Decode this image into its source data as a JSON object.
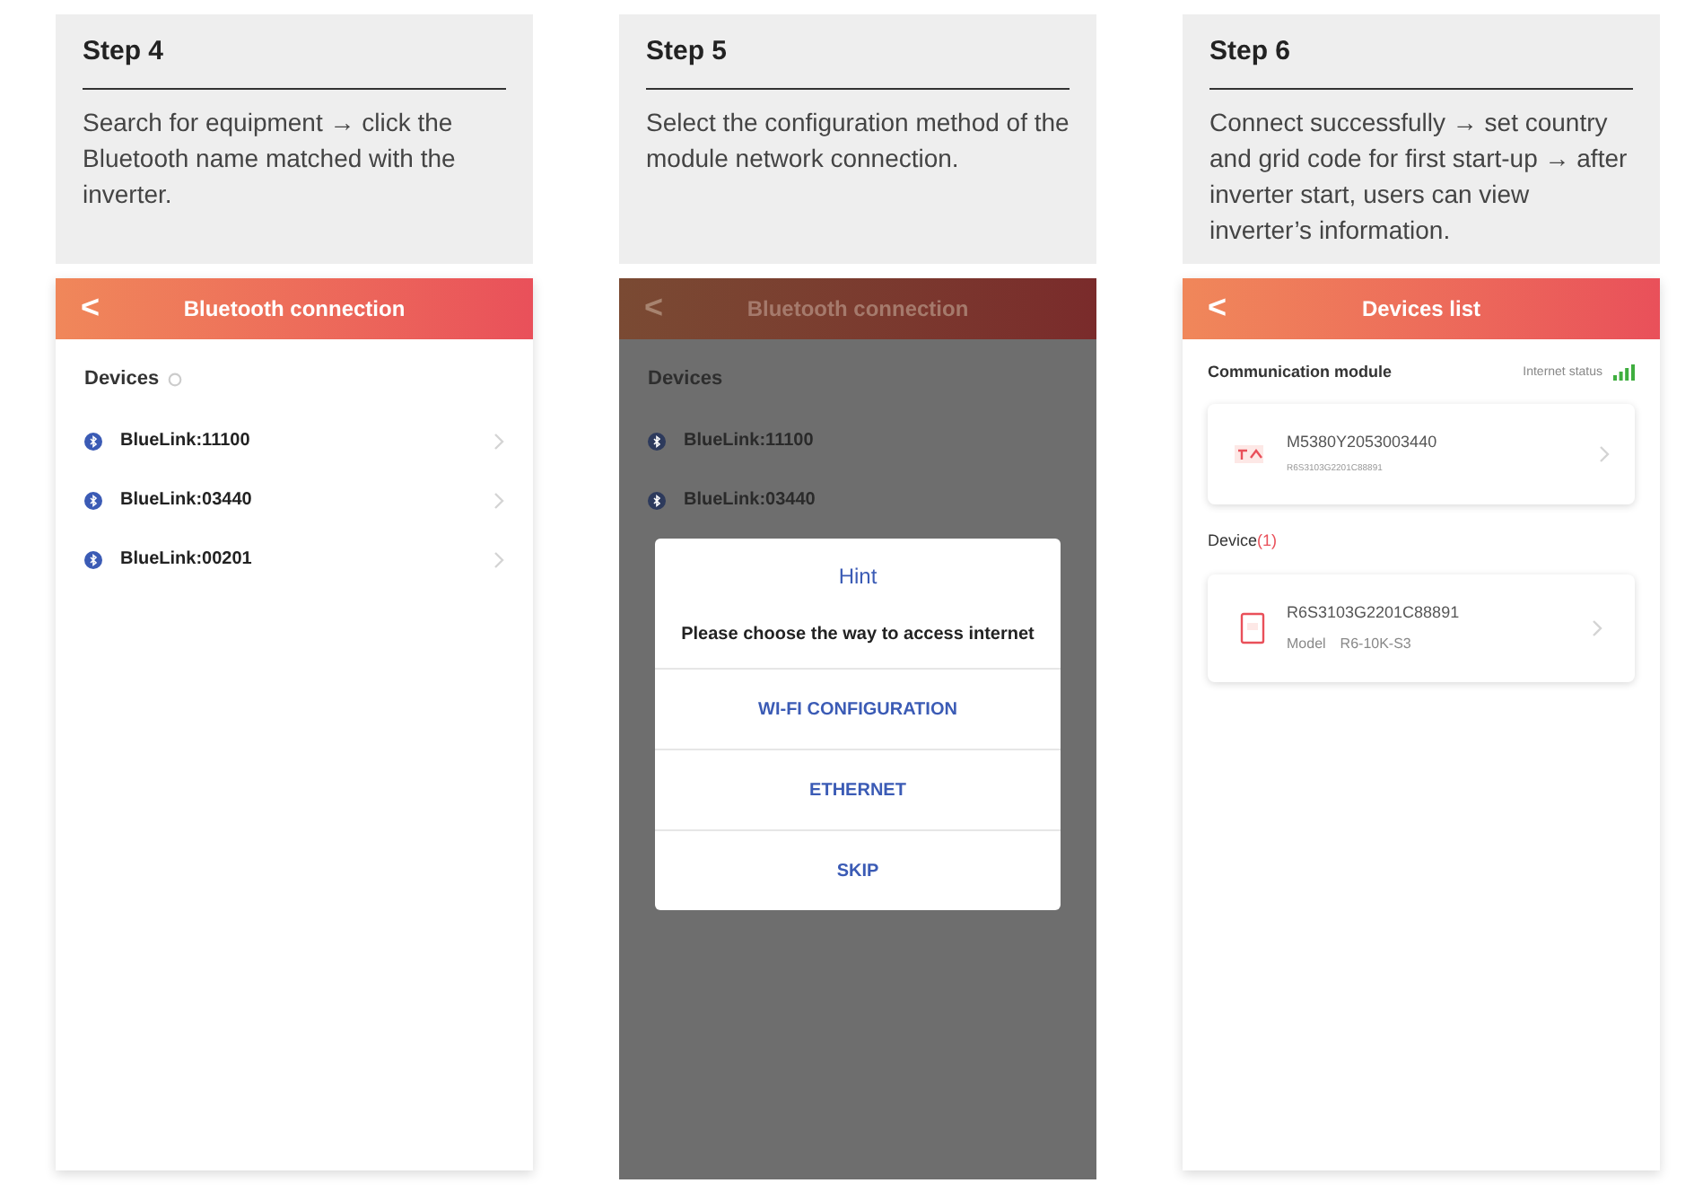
{
  "steps": [
    {
      "title": "Step 4",
      "description": "Search for equipment → click the Bluetooth name matched with the inverter.",
      "screen": {
        "kind": "scan",
        "header": "Bluetooth connection",
        "back": "<",
        "section": "Devices",
        "devices": [
          "BlueLink:11100",
          "BlueLink:03440",
          "BlueLink:00201"
        ]
      }
    },
    {
      "title": "Step 5",
      "description": "Select the configuration method of the module network connection.",
      "screen": {
        "kind": "dialog",
        "header": "Bluetooth connection",
        "back": "<",
        "section": "Devices",
        "devices": [
          "BlueLink:11100",
          "BlueLink:03440"
        ],
        "dialog": {
          "title": "Hint",
          "message": "Please choose the way to access internet",
          "options": [
            "WI-FI CONFIGURATION",
            "ETHERNET",
            "SKIP"
          ]
        }
      }
    },
    {
      "title": "Step 6",
      "description": "Connect successfully → set country and grid code for first start-up → after inverter start, users can view inverter’s information.",
      "screen": {
        "kind": "list",
        "header": "Devices list",
        "back": "<",
        "module_label": "Communication module",
        "status_label": "Internet status",
        "module": {
          "serial": "M5380Y2053003440",
          "sub": "R6S3103G2201C88891"
        },
        "device_label": "Device",
        "device_count": "(1)",
        "device": {
          "serial": "R6S3103G2201C88891",
          "model_label": "Model",
          "model": "R6-10K-S3"
        }
      }
    }
  ]
}
